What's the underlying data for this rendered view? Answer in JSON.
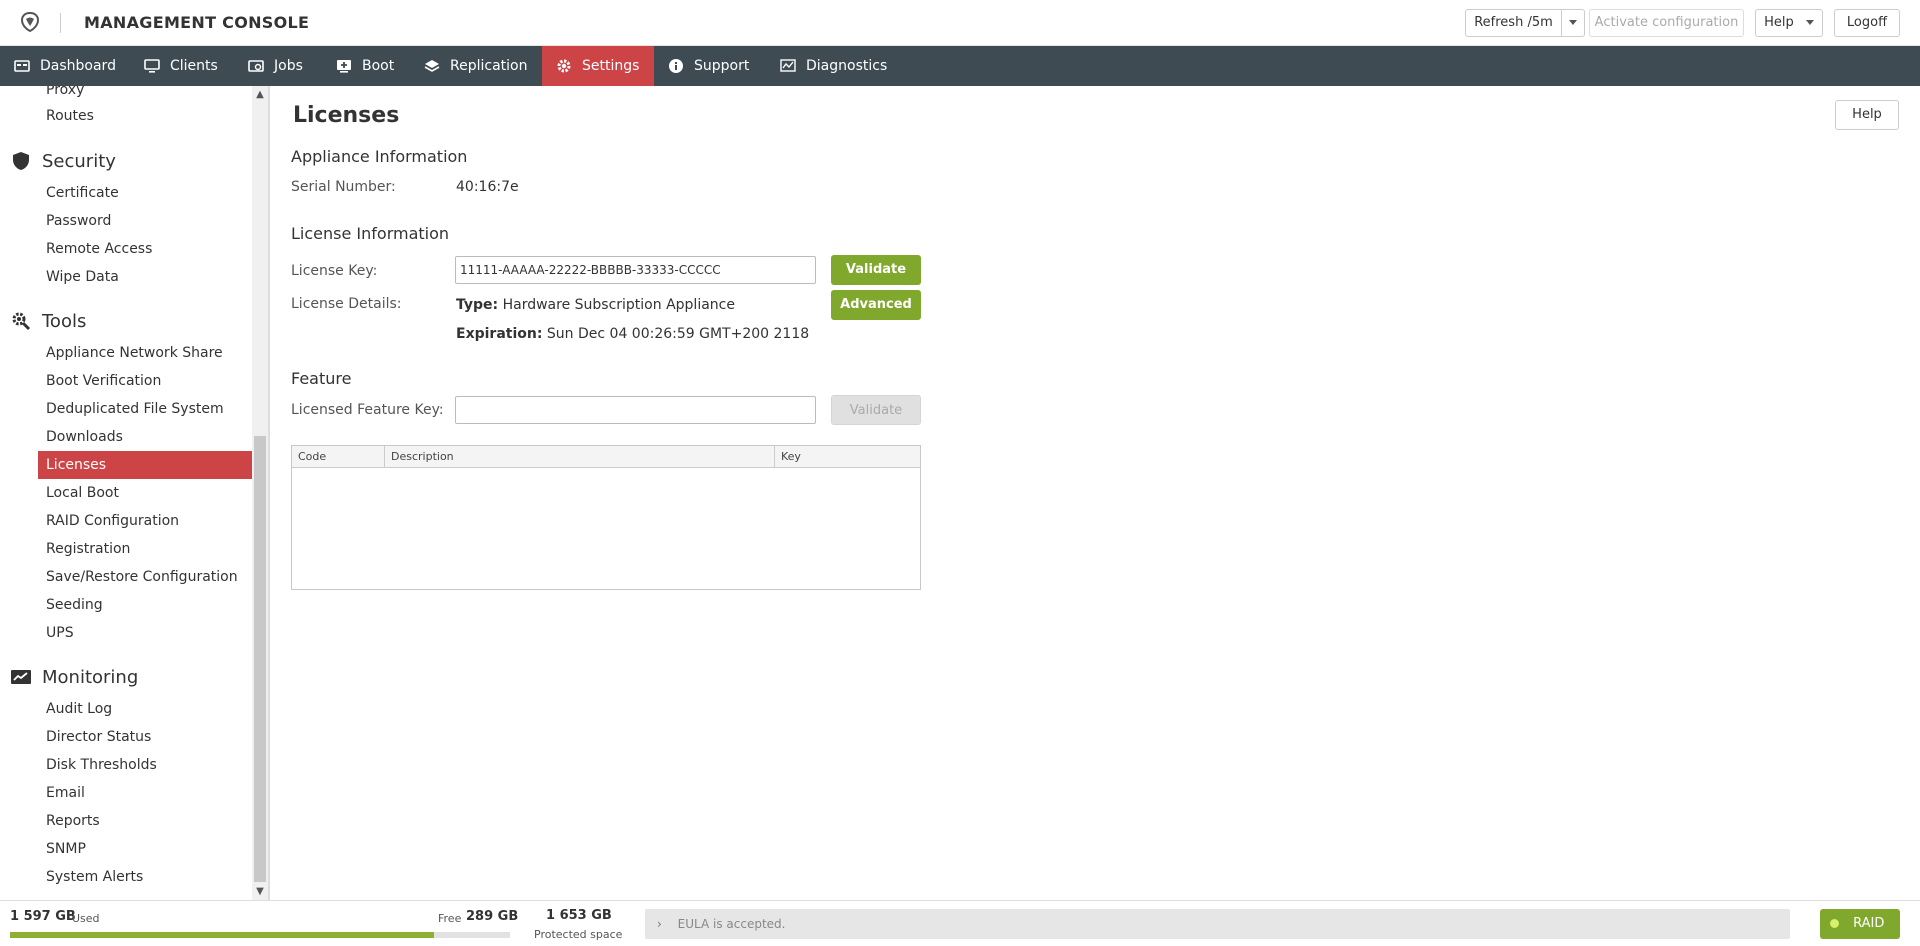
{
  "header": {
    "title": "MANAGEMENT CONSOLE",
    "refresh_label": "Refresh /5m",
    "activate_label": "Activate configuration",
    "help_label": "Help",
    "logoff_label": "Logoff"
  },
  "nav": {
    "items": [
      {
        "label": "Dashboard",
        "icon": "dashboard-icon"
      },
      {
        "label": "Clients",
        "icon": "monitor-icon"
      },
      {
        "label": "Jobs",
        "icon": "jobs-icon"
      },
      {
        "label": "Boot",
        "icon": "boot-icon"
      },
      {
        "label": "Replication",
        "icon": "layers-icon"
      },
      {
        "label": "Settings",
        "icon": "gear-icon",
        "active": true
      },
      {
        "label": "Support",
        "icon": "info-icon"
      },
      {
        "label": "Diagnostics",
        "icon": "chart-icon"
      }
    ]
  },
  "sidebar": {
    "pre_items": [
      "Proxy",
      "Routes"
    ],
    "sections": [
      {
        "title": "Security",
        "icon": "shield-icon",
        "items": [
          "Certificate",
          "Password",
          "Remote Access",
          "Wipe Data"
        ]
      },
      {
        "title": "Tools",
        "icon": "tools-icon",
        "items": [
          "Appliance Network Share",
          "Boot Verification",
          "Deduplicated File System",
          "Downloads",
          "Licenses",
          "Local Boot",
          "RAID Configuration",
          "Registration",
          "Save/Restore Configuration",
          "Seeding",
          "UPS"
        ]
      },
      {
        "title": "Monitoring",
        "icon": "monitoring-icon",
        "items": [
          "Audit Log",
          "Director Status",
          "Disk Thresholds",
          "Email",
          "Reports",
          "SNMP",
          "System Alerts"
        ]
      }
    ],
    "active_item": "Licenses"
  },
  "main": {
    "title": "Licenses",
    "help_label": "Help",
    "appliance_heading": "Appliance Information",
    "serial_label": "Serial Number:",
    "serial_value": "40:16:7e",
    "license_heading": "License Information",
    "license_key_label": "License Key:",
    "license_key_value": "11111-AAAAA-22222-BBBBB-33333-CCCCC",
    "validate_label": "Validate",
    "details_label": "License Details:",
    "type_label": "Type:",
    "type_value": "Hardware Subscription Appliance",
    "advanced_label": "Advanced",
    "expiration_label": "Expiration:",
    "expiration_value": "Sun Dec 04 00:26:59 GMT+200 2118",
    "feature_heading": "Feature",
    "feature_key_label": "Licensed Feature Key:",
    "feature_key_value": "",
    "feature_validate_label": "Validate",
    "table_columns": [
      "Code",
      "Description",
      "Key"
    ]
  },
  "footer": {
    "used_value": "1 597 GB",
    "used_label": "Used",
    "free_label": "Free",
    "free_value": "289 GB",
    "used_fraction": 0.847,
    "protected_value": "1 653 GB",
    "protected_label": "Protected space",
    "eula_text": "EULA is accepted.",
    "raid_label": "RAID"
  },
  "colors": {
    "nav_bg": "#3f4b53",
    "accent_red": "#cd4446",
    "accent_green": "#7fa82c"
  }
}
